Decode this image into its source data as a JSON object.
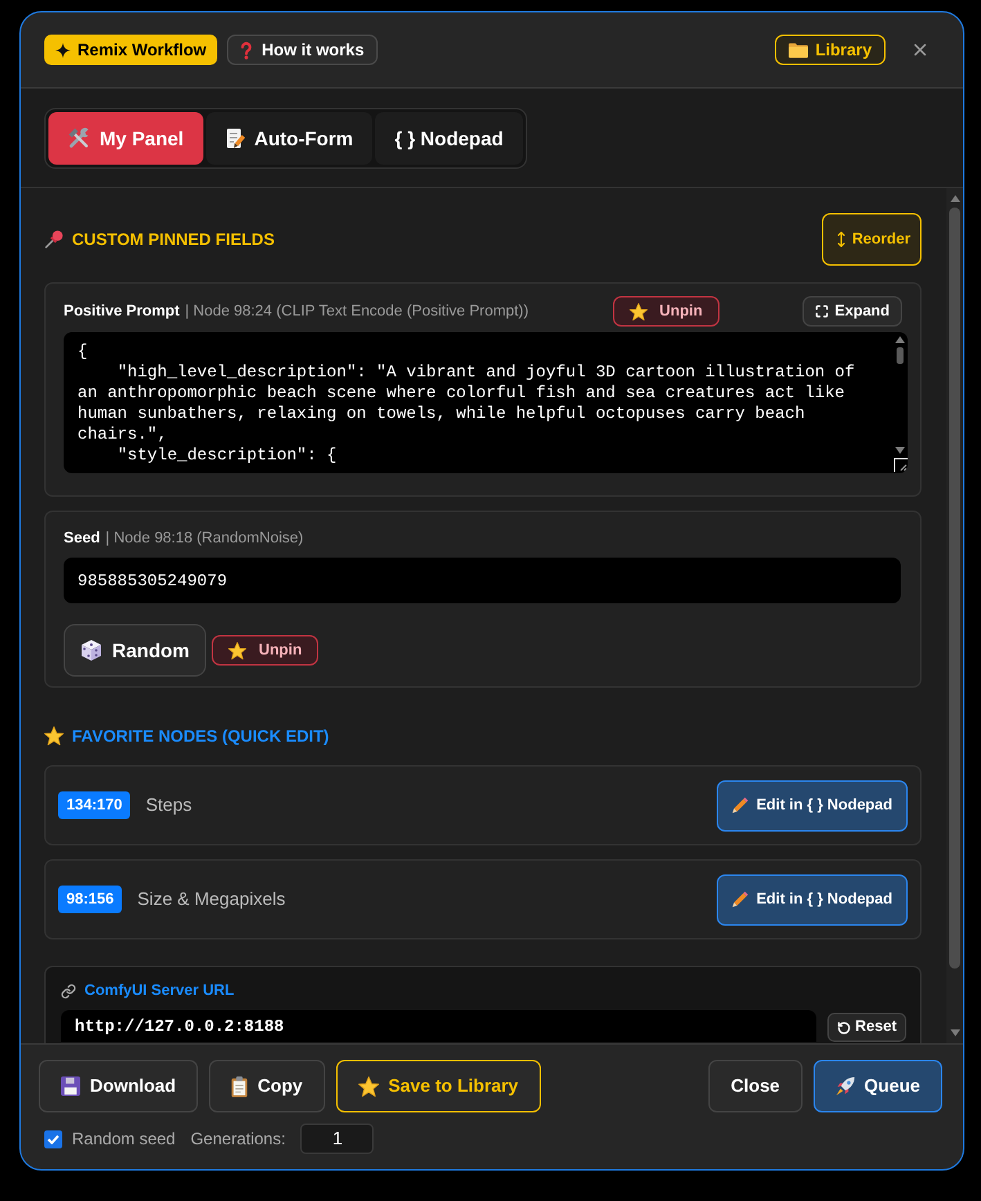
{
  "header": {
    "remix_button": "Remix Workflow",
    "help_button": "How it works",
    "library_button": "Library"
  },
  "tabs": [
    {
      "kind": "panel",
      "label": "My Panel",
      "selected": true
    },
    {
      "kind": "form",
      "label": "Auto-Form",
      "selected": false
    },
    {
      "kind": "nodepad",
      "label": "{ } Nodepad",
      "selected": false
    }
  ],
  "pinned": {
    "title": "CUSTOM PINNED FIELDS",
    "reorder_button": "Reorder",
    "fields": [
      {
        "kind": "textarea",
        "label": "Positive Prompt",
        "node_info": "| Node 98:24 (CLIP Text Encode (Positive Prompt))",
        "unpin_button": "Unpin",
        "expand_button": "Expand",
        "value": "{\n    \"high_level_description\": \"A vibrant and joyful 3D cartoon illustration of an anthropomorphic beach scene where colorful fish and sea creatures act like human sunbathers, relaxing on towels, while helpful octopuses carry beach chairs.\",\n    \"style_description\": {"
      },
      {
        "kind": "seed",
        "label": "Seed",
        "node_info": "| Node 98:18 (RandomNoise)",
        "value": "985885305249079",
        "random_button": "Random",
        "unpin_button": "Unpin"
      }
    ]
  },
  "favorites": {
    "title": "FAVORITE NODES (QUICK EDIT)",
    "nodes": [
      {
        "id": "134:170",
        "name": "Steps",
        "edit_button": "Edit in { } Nodepad"
      },
      {
        "id": "98:156",
        "name": "Size & Megapixels",
        "edit_button": "Edit in { } Nodepad"
      }
    ]
  },
  "server": {
    "label": "ComfyUI Server URL",
    "value": "http://127.0.0.2:8188",
    "reset_button": "Reset"
  },
  "footer": {
    "left_buttons": [
      {
        "kind": "download",
        "label": "Download"
      },
      {
        "kind": "copy",
        "label": "Copy"
      },
      {
        "kind": "save",
        "label": "Save to Library"
      }
    ],
    "right_buttons": [
      {
        "kind": "close",
        "label": "Close"
      },
      {
        "kind": "queue",
        "label": "Queue"
      }
    ],
    "random_seed": {
      "label": "Random seed",
      "checked": true
    },
    "generations": {
      "label": "Generations:",
      "value": "1"
    }
  }
}
